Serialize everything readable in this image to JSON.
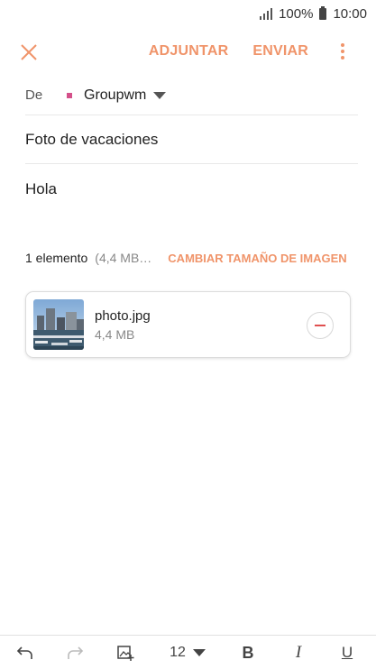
{
  "status_bar": {
    "battery_text": "100%",
    "time": "10:00"
  },
  "toolbar": {
    "attach_label": "ADJUNTAR",
    "send_label": "ENVIAR"
  },
  "from": {
    "label": "De",
    "account": "Groupwm"
  },
  "subject": "Foto de vacaciones",
  "body": "Hola",
  "attachments": {
    "count_text": "1 elemento",
    "size_text": "(4,4 MB…",
    "resize_label": "CAMBIAR TAMAÑO DE IMAGEN",
    "items": [
      {
        "name": "photo.jpg",
        "size": "4,4 MB"
      }
    ]
  },
  "editor_toolbar": {
    "font_size": "12",
    "bold": "B",
    "italic": "I",
    "underline": "U"
  },
  "colors": {
    "accent": "#f0946a",
    "account_dot": "#d4508a",
    "remove": "#e05050"
  }
}
